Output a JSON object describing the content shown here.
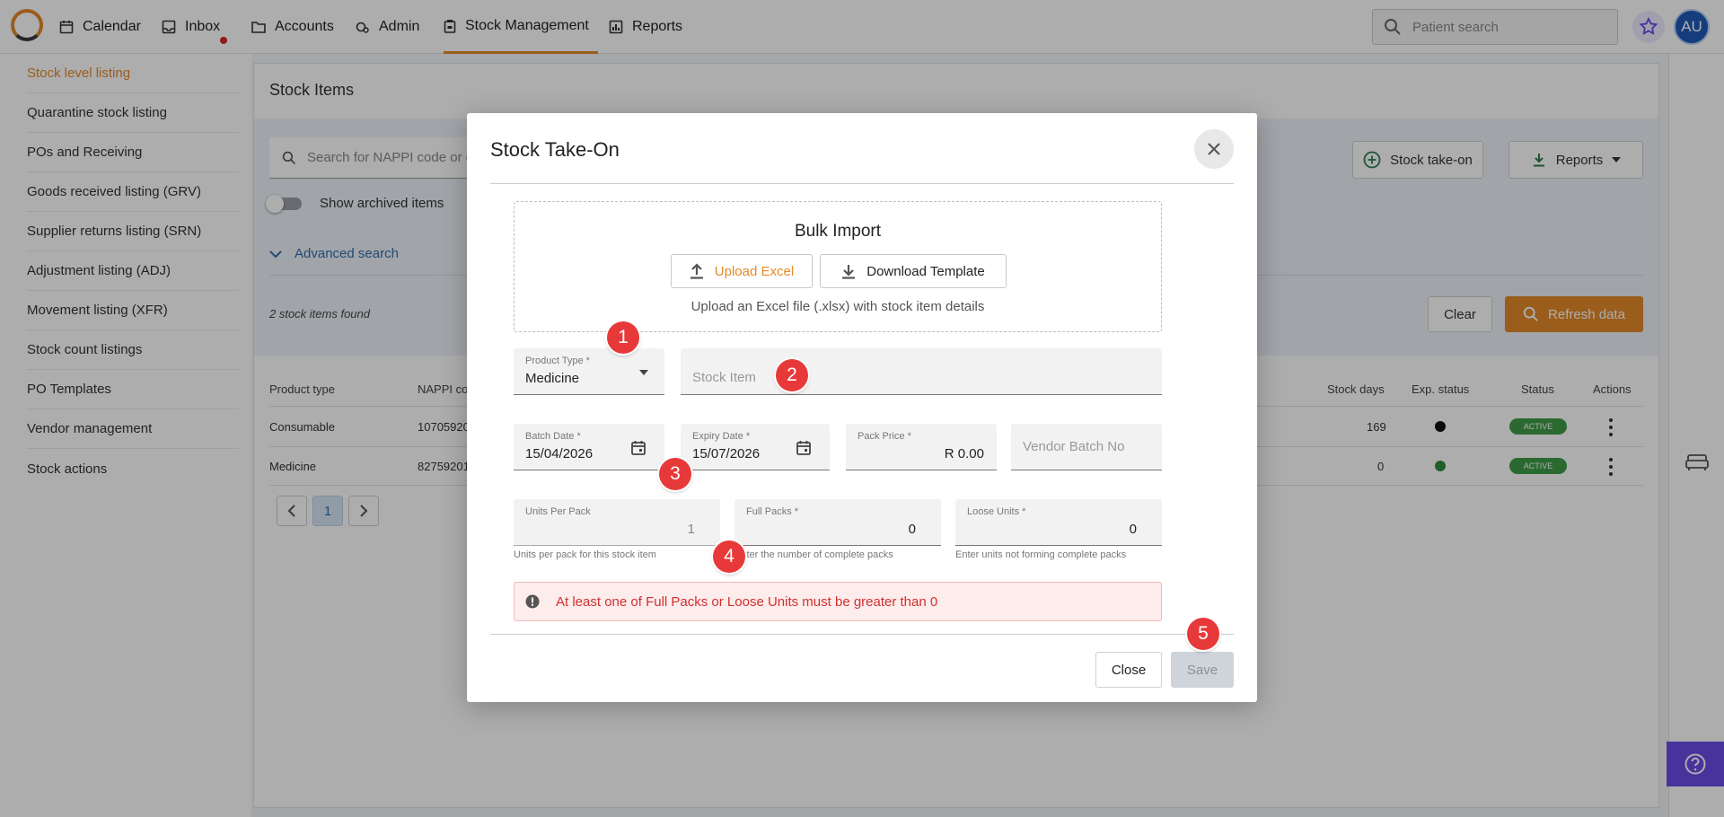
{
  "nav": {
    "items": [
      {
        "label": "Calendar",
        "icon": "calendar-icon"
      },
      {
        "label": "Inbox",
        "icon": "inbox-icon"
      },
      {
        "label": "Accounts",
        "icon": "folder-icon"
      },
      {
        "label": "Admin",
        "icon": "admin-icon"
      },
      {
        "label": "Stock Management",
        "icon": "stock-icon"
      },
      {
        "label": "Reports",
        "icon": "reports-icon"
      }
    ],
    "search_placeholder": "Patient search",
    "avatar_initials": "AU",
    "accent_color": "#e48a2a"
  },
  "sidebar": {
    "items": [
      "Stock level listing",
      "Quarantine stock listing",
      "POs and Receiving",
      "Goods received listing (GRV)",
      "Supplier returns listing (SRN)",
      "Adjustment listing (ADJ)",
      "Movement listing (XFR)",
      "Stock count listings",
      "PO Templates",
      "Vendor management",
      "Stock actions"
    ]
  },
  "page": {
    "title": "Stock Items",
    "search_placeholder": "Search for NAPPI code or d",
    "show_archived_label": "Show archived items",
    "advanced_search_label": "Advanced search",
    "found_label": "2 stock items found",
    "stock_take_on_label": "Stock take-on",
    "reports_label": "Reports",
    "clear_label": "Clear",
    "refresh_label": "Refresh data",
    "columns": {
      "product_type": "Product type",
      "nappi": "NAPPI co",
      "stock_days": "Stock days",
      "exp_status": "Exp. status",
      "status": "Status",
      "actions": "Actions"
    },
    "rows": [
      {
        "product_type": "Consumable",
        "nappi": "10705920",
        "stock_days": "169",
        "exp_color": "#111111",
        "status": "ACTIVE"
      },
      {
        "product_type": "Medicine",
        "nappi": "82759201",
        "stock_days": "0",
        "exp_color": "#2e8b3e",
        "status": "ACTIVE"
      }
    ],
    "pager_current": "1"
  },
  "modal": {
    "title": "Stock Take-On",
    "bulk": {
      "title": "Bulk Import",
      "upload_label": "Upload Excel",
      "download_label": "Download Template",
      "hint": "Upload an Excel file (.xlsx) with stock item details"
    },
    "product_type": {
      "label": "Product Type *",
      "value": "Medicine"
    },
    "stock_item": {
      "placeholder": "Stock Item"
    },
    "batch_date": {
      "label": "Batch Date *",
      "value": "15/04/2026"
    },
    "expiry_date": {
      "label": "Expiry Date *",
      "value": "15/07/2026"
    },
    "pack_price": {
      "label": "Pack Price *",
      "value": "R 0.00"
    },
    "vendor_batch": {
      "placeholder": "Vendor Batch No"
    },
    "units_per_pack": {
      "label": "Units Per Pack",
      "value": "1",
      "helper": "Units per pack for this stock item"
    },
    "full_packs": {
      "label": "Full Packs *",
      "value": "0",
      "helper": "Enter the number of complete packs"
    },
    "loose_units": {
      "label": "Loose Units *",
      "value": "0",
      "helper": "Enter units not forming complete packs"
    },
    "error": "At least one of Full Packs or Loose Units must be greater than 0",
    "close_label": "Close",
    "save_label": "Save"
  },
  "steps": [
    "1",
    "2",
    "3",
    "4",
    "5"
  ]
}
